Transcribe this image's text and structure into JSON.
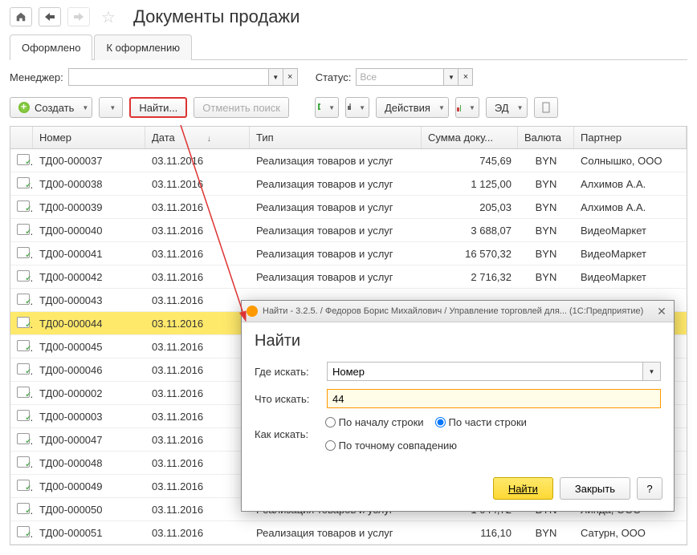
{
  "header": {
    "page_title": "Документы продажи"
  },
  "tabs": {
    "active": "Оформлено",
    "inactive": "К оформлению"
  },
  "filters": {
    "manager_label": "Менеджер:",
    "manager_value": "",
    "status_label": "Статус:",
    "status_value": "Все"
  },
  "toolbar": {
    "create": "Создать",
    "find": "Найти...",
    "cancel_search": "Отменить поиск",
    "actions": "Действия",
    "ed": "ЭД"
  },
  "grid": {
    "headers": {
      "number": "Номер",
      "date": "Дата",
      "type": "Тип",
      "sum": "Сумма доку...",
      "currency": "Валюта",
      "partner": "Партнер"
    },
    "rows": [
      {
        "num": "ТД00-000037",
        "date": "03.11.2016",
        "type": "Реализация товаров и услуг",
        "sum": "745,69",
        "cur": "BYN",
        "partner": "Солнышко, ООО"
      },
      {
        "num": "ТД00-000038",
        "date": "03.11.2016",
        "type": "Реализация товаров и услуг",
        "sum": "1 125,00",
        "cur": "BYN",
        "partner": "Алхимов А.А."
      },
      {
        "num": "ТД00-000039",
        "date": "03.11.2016",
        "type": "Реализация товаров и услуг",
        "sum": "205,03",
        "cur": "BYN",
        "partner": "Алхимов А.А."
      },
      {
        "num": "ТД00-000040",
        "date": "03.11.2016",
        "type": "Реализация товаров и услуг",
        "sum": "3 688,07",
        "cur": "BYN",
        "partner": "ВидеоМаркет"
      },
      {
        "num": "ТД00-000041",
        "date": "03.11.2016",
        "type": "Реализация товаров и услуг",
        "sum": "16 570,32",
        "cur": "BYN",
        "partner": "ВидеоМаркет"
      },
      {
        "num": "ТД00-000042",
        "date": "03.11.2016",
        "type": "Реализация товаров и услуг",
        "sum": "2 716,32",
        "cur": "BYN",
        "partner": "ВидеоМаркет"
      },
      {
        "num": "ТД00-000043",
        "date": "03.11.2016",
        "type": "",
        "sum": "",
        "cur": "",
        "partner": ""
      },
      {
        "num": "ТД00-000044",
        "date": "03.11.2016",
        "type": "",
        "sum": "",
        "cur": "",
        "partner": "",
        "selected": true
      },
      {
        "num": "ТД00-000045",
        "date": "03.11.2016",
        "type": "",
        "sum": "",
        "cur": "",
        "partner": ""
      },
      {
        "num": "ТД00-000046",
        "date": "03.11.2016",
        "type": "",
        "sum": "",
        "cur": "",
        "partner": ""
      },
      {
        "num": "ТД00-000002",
        "date": "03.11.2016",
        "type": "",
        "sum": "",
        "cur": "",
        "partner": ""
      },
      {
        "num": "ТД00-000003",
        "date": "03.11.2016",
        "type": "",
        "sum": "",
        "cur": "",
        "partner": ""
      },
      {
        "num": "ТД00-000047",
        "date": "03.11.2016",
        "type": "",
        "sum": "",
        "cur": "",
        "partner": ""
      },
      {
        "num": "ТД00-000048",
        "date": "03.11.2016",
        "type": "",
        "sum": "",
        "cur": "",
        "partner": ""
      },
      {
        "num": "ТД00-000049",
        "date": "03.11.2016",
        "type": "",
        "sum": "",
        "cur": "",
        "partner": ""
      },
      {
        "num": "ТД00-000050",
        "date": "03.11.2016",
        "type": "Реализация товаров и услуг",
        "sum": "1 044,72",
        "cur": "BYN",
        "partner": "Линда, ООО"
      },
      {
        "num": "ТД00-000051",
        "date": "03.11.2016",
        "type": "Реализация товаров и услуг",
        "sum": "116,10",
        "cur": "BYN",
        "partner": "Сатурн, ООО"
      }
    ]
  },
  "dialog": {
    "title": "Найти - 3.2.5. / Федоров Борис Михайлович / Управление торговлей для... (1С:Предприятие)",
    "heading": "Найти",
    "where_label": "Где искать:",
    "where_value": "Номер",
    "what_label": "Что искать:",
    "what_value": "44",
    "how_label": "Как искать:",
    "radio1": "По началу строки",
    "radio2": "По части строки",
    "radio3": "По точному совпадению",
    "find_btn": "Найти",
    "close_btn": "Закрыть",
    "help_btn": "?"
  }
}
